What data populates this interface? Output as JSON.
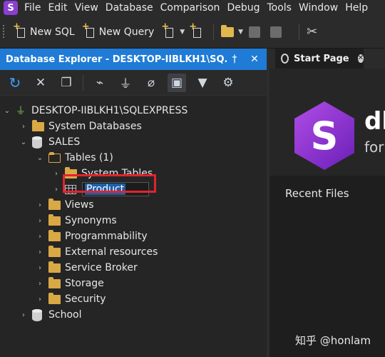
{
  "app": {
    "logo_letter": "S",
    "accent": "#8a3fd1"
  },
  "menu": [
    "File",
    "Edit",
    "View",
    "Database",
    "Comparison",
    "Debug",
    "Tools",
    "Window",
    "Help"
  ],
  "toolbar": {
    "new_sql": "New SQL",
    "new_query": "New Query"
  },
  "explorer": {
    "title": "Database Explorer - DESKTOP-IIBLKH1\\SQ...",
    "pin": "†",
    "close": "✕",
    "header_color": "#1f7bd6"
  },
  "tree": {
    "server": "DESKTOP-IIBLKH1\\SQLEXPRESS",
    "system_databases": "System Databases",
    "sales": "SALES",
    "tables": "Tables (1)",
    "system_tables": "System Tables",
    "product": "Product",
    "views": "Views",
    "synonyms": "Synonyms",
    "programmability": "Programmability",
    "external_resources": "External resources",
    "service_broker": "Service Broker",
    "storage": "Storage",
    "security": "Security",
    "school": "School"
  },
  "right": {
    "tab_label": "Start Page",
    "brand_big": "db",
    "brand_sub": "for",
    "recent_files": "Recent Files"
  },
  "watermark": "知乎 @honlam",
  "highlight_color": "#e3232d"
}
